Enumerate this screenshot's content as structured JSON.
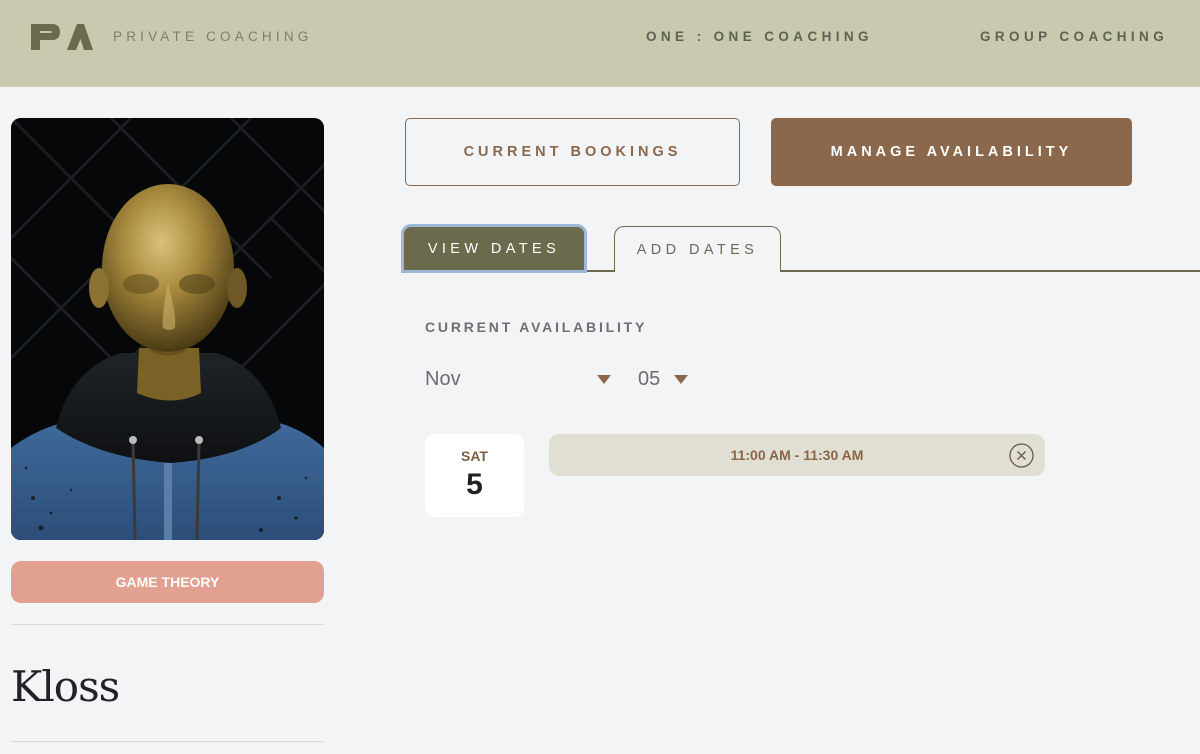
{
  "header": {
    "logo_text": "PA",
    "brand_subtitle": "PRIVATE COACHING",
    "nav": {
      "one_on_one": "ONE : ONE COACHING",
      "group": "GROUP COACHING"
    }
  },
  "profile": {
    "tag_label": "GAME THEORY",
    "name": "Kloss"
  },
  "actions": {
    "current_bookings": "CURRENT BOOKINGS",
    "manage_availability": "MANAGE AVAILABILITY"
  },
  "tabs": {
    "view_dates": "VIEW DATES",
    "add_dates": "ADD DATES",
    "active": "view_dates"
  },
  "availability": {
    "title": "CURRENT AVAILABILITY",
    "month": "Nov",
    "day": "05",
    "entries": [
      {
        "day_of_week": "SAT",
        "day": "5",
        "slot": "11:00 AM - 11:30 AM"
      }
    ]
  },
  "colors": {
    "header_bg": "#c8c9ae",
    "accent_brown": "#8b684b",
    "tag_pink": "#e2a190",
    "tab_olive": "#6b6a4c",
    "slot_bg": "#e1dfd4",
    "page_bg": "#f3f4f6"
  },
  "icons": {
    "dropdown": "caret-down-icon",
    "remove": "close-circle-icon"
  }
}
